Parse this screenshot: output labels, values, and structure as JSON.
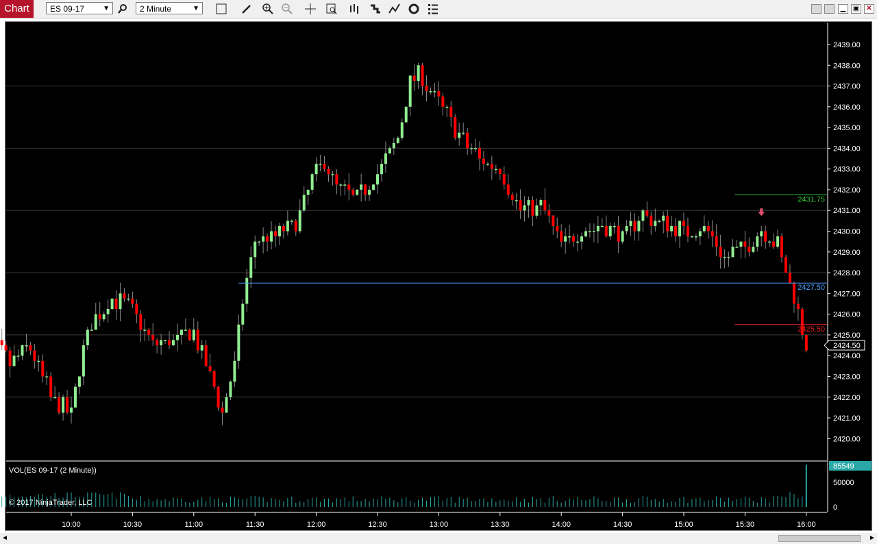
{
  "toolbar": {
    "chart_tab_label": "Chart",
    "instrument": "ES 09-17",
    "interval": "2 Minute",
    "icons": [
      "search-icon",
      "blank-box-icon",
      "pencil-icon",
      "zoom-in-icon",
      "zoom-out-icon",
      "crosshair-icon",
      "data-box-icon",
      "bar-spacing-icon",
      "step-chart-icon",
      "indicator-icon",
      "refresh-icon",
      "list-icon"
    ]
  },
  "window_controls": [
    "restore-small-icon",
    "restore-small-icon",
    "minimize-icon",
    "maximize-icon",
    "close-icon"
  ],
  "colors": {
    "up": "#90ee90",
    "down": "#ff0000",
    "grid": "#3a3a3a",
    "blue_line": "#4aa0ff",
    "green_line": "#33cc33",
    "red_line": "#ee2222",
    "volume": "#2aa8a8",
    "text": "#ffffff"
  },
  "price_axis": {
    "ticks": [
      "2439.00",
      "2438.00",
      "2437.00",
      "2436.00",
      "2435.00",
      "2434.00",
      "2433.00",
      "2432.00",
      "2431.00",
      "2430.00",
      "2429.00",
      "2428.00",
      "2427.00",
      "2426.00",
      "2425.00",
      "2424.00",
      "2423.00",
      "2422.00",
      "2421.00",
      "2420.00"
    ],
    "current_price": "2424.50"
  },
  "time_axis": {
    "ticks": [
      "10:00",
      "10:30",
      "11:00",
      "11:30",
      "12:00",
      "12:30",
      "13:00",
      "13:30",
      "14:00",
      "14:30",
      "15:00",
      "15:30",
      "16:00"
    ]
  },
  "levels": [
    {
      "label": "2431.75",
      "price": 2431.75,
      "color": "#33cc33",
      "from": "15:25"
    },
    {
      "label": "2427.50",
      "price": 2427.5,
      "color": "#4aa0ff",
      "from": "11:22"
    },
    {
      "label": "2425.50",
      "price": 2425.5,
      "color": "#ee2222",
      "from": "15:25"
    }
  ],
  "volume_panel": {
    "title": "VOL(ES 09-17 (2 Minute))",
    "ticks": [
      "50000",
      "0"
    ],
    "current_value": "85549",
    "last_bar_volume": 85549
  },
  "copyright": "© 2017 NinjaTrader, LLC",
  "chart_data": {
    "type": "candlestick",
    "instrument": "ES 09-17",
    "interval": "2 Minute",
    "time_range": [
      "09:12",
      "16:00"
    ],
    "ylim": [
      2419.6,
      2439.5
    ],
    "approximate_closes": {
      "09:12": 2426.4,
      "09:20": 2425.0,
      "09:30": 2423.6,
      "09:40": 2424.4,
      "09:50": 2422.0,
      "10:00": 2421.2,
      "10:04": 2423.5,
      "10:10": 2425.6,
      "10:20": 2426.8,
      "10:30": 2426.2,
      "10:40": 2424.5,
      "10:50": 2424.7,
      "11:00": 2425.1,
      "11:08": 2423.0,
      "11:14": 2421.3,
      "11:20": 2423.6,
      "11:24": 2426.6,
      "11:30": 2429.5,
      "11:40": 2429.8,
      "11:50": 2430.4,
      "11:58": 2432.4,
      "12:04": 2433.4,
      "12:10": 2432.1,
      "12:20": 2431.5,
      "12:30": 2432.8,
      "12:40": 2434.5,
      "12:46": 2437.2,
      "12:50": 2437.6,
      "13:00": 2436.2,
      "13:10": 2434.6,
      "13:20": 2433.5,
      "13:30": 2433.0,
      "13:40": 2431.0,
      "13:50": 2431.2,
      "14:00": 2429.4,
      "14:10": 2430.0,
      "14:20": 2430.3,
      "14:30": 2429.7,
      "14:40": 2430.8,
      "14:50": 2430.4,
      "15:00": 2430.0,
      "15:10": 2430.2,
      "15:20": 2428.8,
      "15:30": 2429.2,
      "15:38": 2430.2,
      "15:46": 2429.3,
      "15:54": 2426.8,
      "16:00": 2424.5
    },
    "sell_marker_time": "15:38"
  }
}
